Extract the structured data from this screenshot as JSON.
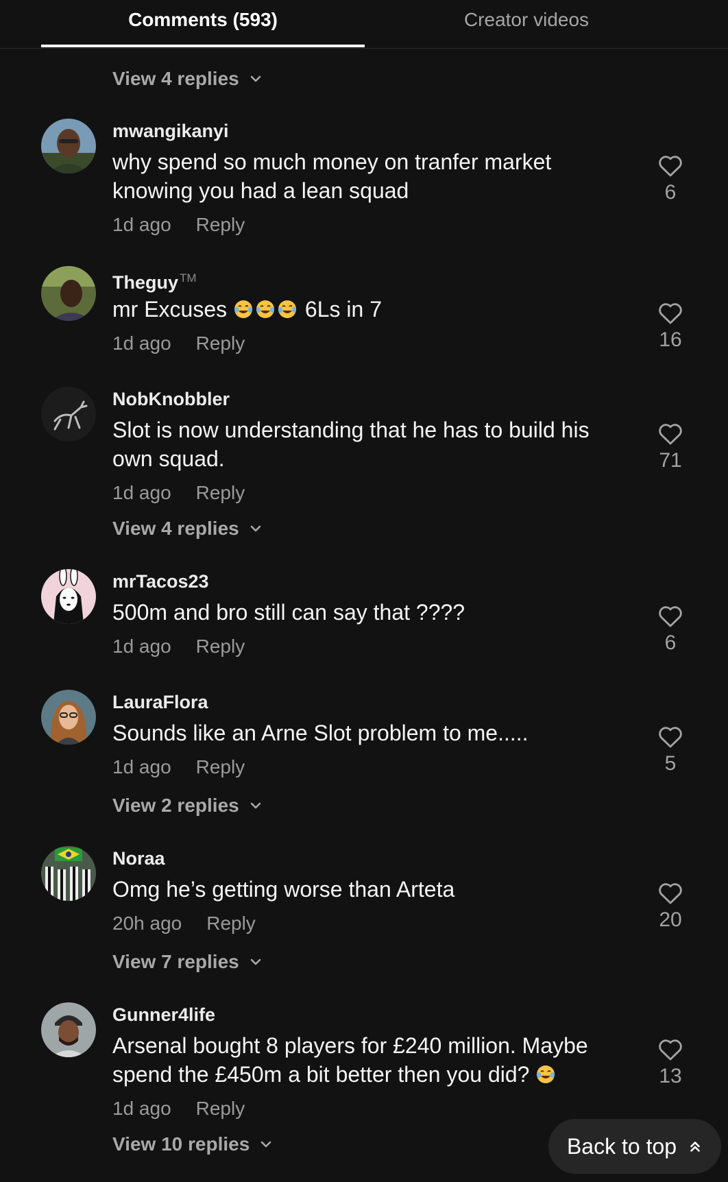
{
  "tabs": {
    "comments_label": "Comments (593)",
    "creator_label": "Creator videos"
  },
  "top_view_replies": "View 4 replies",
  "reply_label": "Reply",
  "back_to_top": "Back to top",
  "colors": {
    "background": "#121212",
    "text_primary": "#ffffff",
    "text_secondary": "#9b9b9b"
  },
  "comments": [
    {
      "username": "mwangikanyi",
      "text_lines": [
        "why spend so much money on tranfer market",
        "knowing you had a lean squad"
      ],
      "time": "1d ago",
      "likes": "6",
      "view_replies": ""
    },
    {
      "username": "Theguy",
      "username_suffix": "TM",
      "text_before_emoji": "mr Excuses",
      "emojis": [
        "laughing-tears-emoji",
        "laughing-tears-emoji",
        "laughing-tears-emoji"
      ],
      "text_after_emoji": "6Ls in 7",
      "time": "1d ago",
      "likes": "16",
      "view_replies": ""
    },
    {
      "username": "NobKnobbler",
      "text_lines": [
        "Slot is now understanding that he has to build his",
        "own squad."
      ],
      "time": "1d ago",
      "likes": "71",
      "view_replies": "View 4 replies"
    },
    {
      "username": "mrTacos23",
      "text_lines": [
        "500m and bro still can say that ????"
      ],
      "time": "1d ago",
      "likes": "6",
      "view_replies": ""
    },
    {
      "username": "LauraFlora",
      "text_lines": [
        "Sounds like an Arne Slot problem to me....."
      ],
      "time": "1d ago",
      "likes": "5",
      "view_replies": "View 2 replies"
    },
    {
      "username": "Noraa",
      "text_lines": [
        "Omg he’s getting worse than Arteta"
      ],
      "time": "20h ago",
      "likes": "20",
      "view_replies": "View 7 replies"
    },
    {
      "username": "Gunner4life",
      "text_lines": [
        "Arsenal bought 8 players for £240 million. Maybe",
        "spend the £450m a bit better then you did?"
      ],
      "trailing_emoji": "laughing-tears-emoji",
      "time": "1d ago",
      "likes": "13",
      "view_replies": "View 10 replies"
    }
  ]
}
